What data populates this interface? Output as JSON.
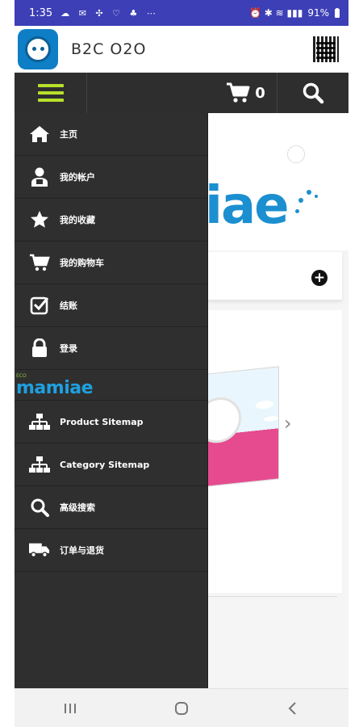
{
  "status": {
    "time": "1:35",
    "left_icons": "☁ ✉ ✣ ♡ ♣ ⋯",
    "right_icons": "⏰ ✱ ≋ ▮▮▮",
    "battery": "91%"
  },
  "app": {
    "title": "B2C O2O"
  },
  "toolbar": {
    "cart_count": "0"
  },
  "drawer": {
    "items": [
      {
        "label": "主页",
        "icon": "home-icon"
      },
      {
        "label": "我的帐户",
        "icon": "user-icon"
      },
      {
        "label": "我的收藏",
        "icon": "star-icon"
      },
      {
        "label": "我的购物车",
        "icon": "cart-icon"
      },
      {
        "label": "结账",
        "icon": "checkbox-icon"
      },
      {
        "label": "登录",
        "icon": "lock-icon"
      }
    ],
    "brand_small": "ECO",
    "brand_name": "mamiae",
    "items2": [
      {
        "label": "Product Sitemap",
        "icon": "sitemap-icon"
      },
      {
        "label": "Category Sitemap",
        "icon": "sitemap-icon"
      },
      {
        "label": "高级搜索",
        "icon": "search-icon"
      },
      {
        "label": "订单与退货",
        "icon": "truck-icon"
      }
    ]
  },
  "background": {
    "brand_text": "iae"
  },
  "colors": {
    "statusbar": "#3c3fb5",
    "toolbar": "#2e2e2e",
    "drawer": "#2f2f2f",
    "menu_accent": "#b8e02a",
    "brand_blue": "#1c8fd0"
  }
}
